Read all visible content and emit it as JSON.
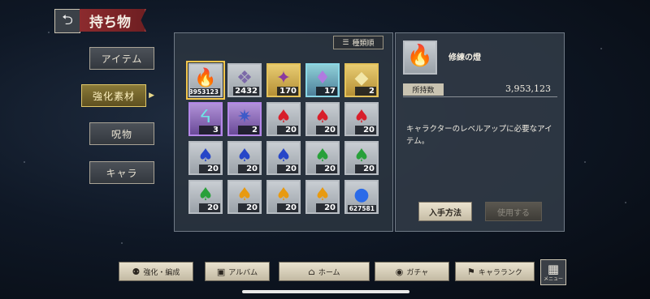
{
  "header": {
    "back_icon": "back-arrow-icon",
    "title": "持ち物"
  },
  "side_tabs": [
    {
      "label": "アイテム",
      "active": false
    },
    {
      "label": "強化素材",
      "active": true
    },
    {
      "label": "呪物",
      "active": false
    },
    {
      "label": "キャラ",
      "active": false
    }
  ],
  "sort_button": {
    "label": "種類順",
    "icon": "sort-icon"
  },
  "items": [
    {
      "qty": "3953123",
      "frame": "gray",
      "gem": "🔥",
      "color": "#e8401a",
      "selected": true
    },
    {
      "qty": "2432",
      "frame": "gray",
      "gem": "❖",
      "color": "#7c6aa8"
    },
    {
      "qty": "170",
      "frame": "gold",
      "gem": "✦",
      "color": "#8a3a9e"
    },
    {
      "qty": "17",
      "frame": "teal",
      "gem": "♦",
      "color": "#b07be0"
    },
    {
      "qty": "2",
      "frame": "gold",
      "gem": "◆",
      "color": "#f2e6a8"
    },
    {
      "qty": "3",
      "frame": "purple",
      "gem": "ᔦ",
      "color": "#6ee6e6"
    },
    {
      "qty": "2",
      "frame": "purple",
      "gem": "✷",
      "color": "#3e5ac8"
    },
    {
      "qty": "20",
      "frame": "gray",
      "gem": "♠",
      "color": "#d81e2a"
    },
    {
      "qty": "20",
      "frame": "gray",
      "gem": "♠",
      "color": "#d81e2a"
    },
    {
      "qty": "20",
      "frame": "gray",
      "gem": "♠",
      "color": "#d81e2a"
    },
    {
      "qty": "20",
      "frame": "gray",
      "gem": "♠",
      "color": "#2646c8"
    },
    {
      "qty": "20",
      "frame": "gray",
      "gem": "♠",
      "color": "#2646c8"
    },
    {
      "qty": "20",
      "frame": "gray",
      "gem": "♠",
      "color": "#2646c8"
    },
    {
      "qty": "20",
      "frame": "gray",
      "gem": "♠",
      "color": "#28a03a"
    },
    {
      "qty": "20",
      "frame": "gray",
      "gem": "♠",
      "color": "#28a03a"
    },
    {
      "qty": "20",
      "frame": "gray",
      "gem": "♠",
      "color": "#28a03a"
    },
    {
      "qty": "20",
      "frame": "gray",
      "gem": "♠",
      "color": "#e89a10"
    },
    {
      "qty": "20",
      "frame": "gray",
      "gem": "♠",
      "color": "#e89a10"
    },
    {
      "qty": "20",
      "frame": "gray",
      "gem": "♠",
      "color": "#e89a10"
    },
    {
      "qty": "627581",
      "frame": "gray",
      "gem": "●",
      "color": "#2a6ae8"
    }
  ],
  "detail": {
    "icon": "flame-orb-icon",
    "name": "修練の燈",
    "owned_label": "所持数",
    "owned_value": "3,953,123",
    "description": "キャラクターのレベルアップに必要なアイテム。",
    "obtain_label": "入手方法",
    "use_label": "使用する"
  },
  "bottom_nav": [
    {
      "label": "強化・編成",
      "icon": "team-icon"
    },
    {
      "label": "アルバム",
      "icon": "album-icon"
    },
    {
      "label": "ホーム",
      "icon": "home-icon"
    },
    {
      "label": "ガチャ",
      "icon": "gacha-icon"
    },
    {
      "label": "キャラランク",
      "icon": "rank-icon"
    }
  ],
  "menu_button": {
    "label": "メニュー",
    "icon": "grid-menu-icon"
  }
}
